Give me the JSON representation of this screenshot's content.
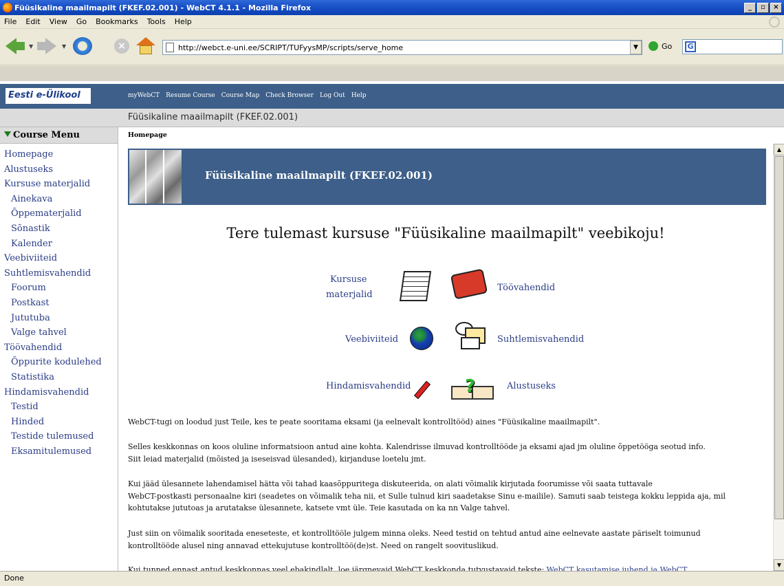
{
  "window": {
    "title": "Füüsikaline maailmapilt (FKEF.02.001) - WebCT 4.1.1 - Mozilla Firefox",
    "btn_min": "_",
    "btn_max": "▫",
    "btn_close": "×"
  },
  "menubar": {
    "items": [
      "File",
      "Edit",
      "View",
      "Go",
      "Bookmarks",
      "Tools",
      "Help"
    ]
  },
  "navbar": {
    "url": "http://webct.e-uni.ee/SCRIPT/TUFyysMP/scripts/serve_home",
    "go_label": "Go",
    "search_icon": "google-icon",
    "search_glyph": "G"
  },
  "webct": {
    "logo_text": "Eesti e-Ülikool",
    "links": [
      "myWebCT",
      "Resume Course",
      "Course Map",
      "Check Browser",
      "Log Out",
      "Help"
    ],
    "course_title": "Füüsikaline maailmapilt (FKEF.02.001)"
  },
  "sidebar": {
    "heading": "Course Menu",
    "items": [
      {
        "label": "Homepage",
        "level": 0
      },
      {
        "label": "Alustuseks",
        "level": 0
      },
      {
        "label": "Kursuse materjalid",
        "level": 0
      },
      {
        "label": "Ainekava",
        "level": 1
      },
      {
        "label": "Õppematerjalid",
        "level": 1
      },
      {
        "label": "Sõnastik",
        "level": 1
      },
      {
        "label": "Kalender",
        "level": 1
      },
      {
        "label": "Veebiviiteid",
        "level": 0
      },
      {
        "label": "Suhtlemisvahendid",
        "level": 0
      },
      {
        "label": "Foorum",
        "level": 1
      },
      {
        "label": "Postkast",
        "level": 1
      },
      {
        "label": "Jututuba",
        "level": 1
      },
      {
        "label": "Valge tahvel",
        "level": 1
      },
      {
        "label": "Töövahendid",
        "level": 0
      },
      {
        "label": "Õppurite kodulehed",
        "level": 1
      },
      {
        "label": "Statistika",
        "level": 1
      },
      {
        "label": "Hindamisvahendid",
        "level": 0
      },
      {
        "label": "Testid",
        "level": 1
      },
      {
        "label": "Hinded",
        "level": 1
      },
      {
        "label": "Testide tulemused",
        "level": 1
      },
      {
        "label": "Eksamitulemused",
        "level": 1
      }
    ]
  },
  "main": {
    "breadcrumb": "Homepage",
    "banner_title": "Füüsikaline maailmapilt (FKEF.02.001)",
    "welcome": "Tere tulemast kursuse \"Füüsikaline maailmapilt\" veebikoju!",
    "links": {
      "kursuse_line1": "Kursuse",
      "kursuse_line2": "materjalid",
      "toovahendid": "Töövahendid",
      "veebiviiteid": "Veebiviiteid",
      "suhtlemis": "Suhtlemisvahendid",
      "hindamis": "Hindamisvahendid",
      "alustuseks": "Alustuseks"
    },
    "paragraphs": {
      "p1": "WebCT-tugi on loodud just Teile, kes te peate sooritama eksami (ja eelnevalt kontrolltööd) aines \"Füüsikaline maailmapilt\".",
      "p2a": "Selles keskkonnas on koos oluline informatsioon antud aine kohta. Kalendrisse ilmuvad kontrolltööde ja eksami ajad jm oluline õppetööga seotud info.",
      "p2b": "Siit leiad materjalid (mõisted ja iseseisvad ülesanded), kirjanduse loetelu jmt.",
      "p3a": "Kui jääd ülesannete lahendamisel hätta või tahad kaasõppuritega diskuteerida, on alati võimalik kirjutada foorumisse või saata tuttavale",
      "p3b": "WebCT-postkasti personaalne kiri (seadetes on võimalik teha nii, et Sulle tulnud kiri saadetakse Sinu e-mailile). Samuti saab teistega kokku leppida aja, mil",
      "p3c": "kohtutakse jututoas ja arutatakse ülesannete, katsete vmt üle. Teie kasutada on ka nn Valge tahvel.",
      "p4a": "Just siin on võimalik sooritada enesetestе, et kontrolltööle julgem minna oleks. Need testid on tehtud antud aine eelnevate aastate päriselt toimunud",
      "p4b": "kontrolltööde alusel ning annavad ettekujutuse kontrolltöö(de)st. Need on rangelt soovituslikud.",
      "p5_text": "Kui tunned ennast antud keskkonnas veel ebakindlalt, loe järgnevaid WebCT keskkonda tutvustavaid tekste: ",
      "p5_link": "WebCT kasutamise juhend ja WebCT"
    }
  },
  "status": {
    "text": "Done"
  }
}
